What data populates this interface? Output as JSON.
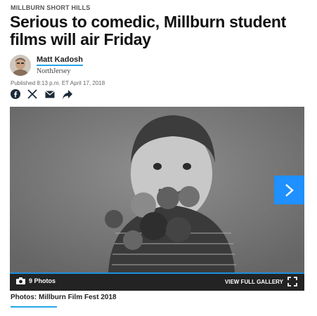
{
  "article": {
    "section": "MILLBURN SHORT HILLS",
    "headline": "Serious to comedic, Millburn student films will air Friday",
    "author_name": "Matt Kadosh",
    "author_org": "NorthJersey",
    "published": "Published 8:13 p.m. ET April 17, 2018"
  },
  "share_icons": [
    "facebook-icon",
    "x-icon",
    "email-icon",
    "share-arrow-icon"
  ],
  "gallery": {
    "photo_count": "9 Photos",
    "view_full_label": "VIEW FULL GALLERY",
    "caption": "Photos: Millburn Film Fest 2018"
  },
  "colors": {
    "accent_blue": "#1e90ff",
    "underline_blue": "#26a6e8",
    "bar_dark": "#232323"
  }
}
